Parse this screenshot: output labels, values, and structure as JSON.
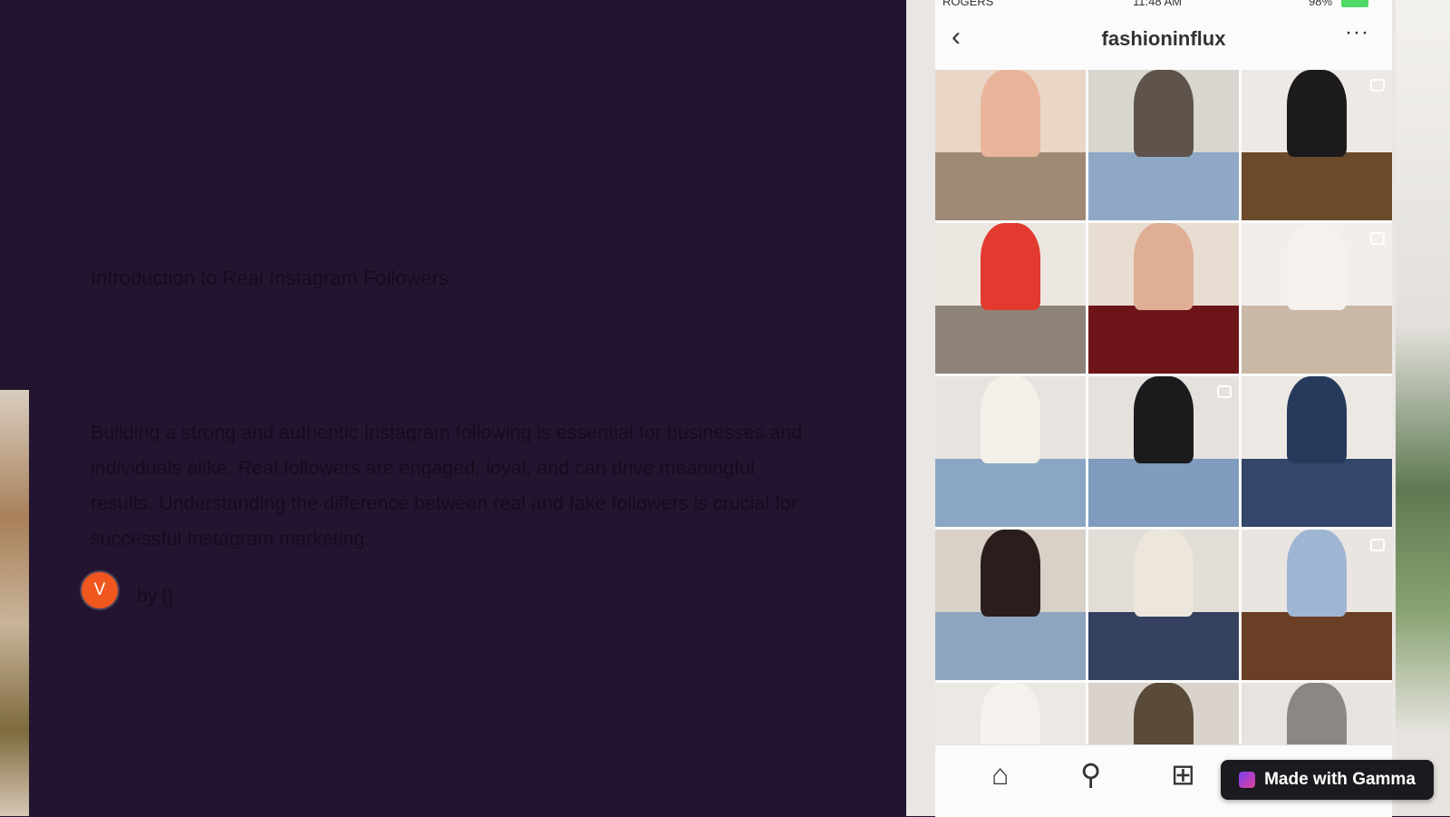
{
  "slide": {
    "title": "Introduction to Real Instagram Followers",
    "body": "Building a strong and authentic Instagram following is essential for businesses and individuals alike. Real followers are engaged, loyal, and can drive meaningful results. Understanding the difference between real and fake followers is crucial for successful Instagram marketing.",
    "author": {
      "initial": "V",
      "byline": "by []"
    }
  },
  "phone": {
    "status": {
      "carrier": "ROGERS",
      "time": "11:48 AM",
      "battery": "98%"
    },
    "header": {
      "username": "fashioninflux",
      "back_icon": "chevron-left-icon",
      "more_icon": "more-dots-icon"
    },
    "grid": {
      "rows": 5,
      "cols": 3,
      "tiles": [
        {
          "top": "#e9d6c7",
          "bottom": "#a08a76",
          "accent": "#e9b59a",
          "multi": false
        },
        {
          "top": "#d9d5cf",
          "bottom": "#8fa8c6",
          "accent": "#5e544b",
          "multi": false
        },
        {
          "top": "#ede9e4",
          "bottom": "#6b4a2c",
          "accent": "#1c1a1b",
          "multi": true
        },
        {
          "top": "#ece7e1",
          "bottom": "#8e8379",
          "accent": "#e23a2e",
          "multi": false
        },
        {
          "top": "#e8ddd1",
          "bottom": "#6d1418",
          "accent": "#dfae94",
          "multi": false
        },
        {
          "top": "#f1eeeb",
          "bottom": "#c9b8a6",
          "accent": "#f4f1ee",
          "multi": true
        },
        {
          "top": "#e7e3de",
          "bottom": "#8aa6c4",
          "accent": "#f3efe9",
          "multi": false
        },
        {
          "top": "#e5e2de",
          "bottom": "#7f9bbd",
          "accent": "#1b1b1d",
          "multi": true
        },
        {
          "top": "#ece8e4",
          "bottom": "#34466a",
          "accent": "#263a5c",
          "multi": false
        },
        {
          "top": "#d9d1c8",
          "bottom": "#8ea5c0",
          "accent": "#2a1d1b",
          "multi": false
        },
        {
          "top": "#e2ddd6",
          "bottom": "#34415f",
          "accent": "#ece6dc",
          "multi": false
        },
        {
          "top": "#e9e6e2",
          "bottom": "#6b3e26",
          "accent": "#9fb6d3",
          "multi": true
        },
        {
          "top": "#ece9e5",
          "bottom": "#d8d4cf",
          "accent": "#f5f2ee",
          "multi": false
        },
        {
          "top": "#d9d3cc",
          "bottom": "#6a5643",
          "accent": "#5a4a3a",
          "multi": false
        },
        {
          "top": "#e7e3df",
          "bottom": "#9b9690",
          "accent": "#8b8883",
          "multi": false
        }
      ]
    },
    "nav": {
      "home_icon": "⌂",
      "search_icon": "⚲",
      "add_icon": "⊞"
    }
  },
  "badge": {
    "label": "Made with Gamma"
  }
}
